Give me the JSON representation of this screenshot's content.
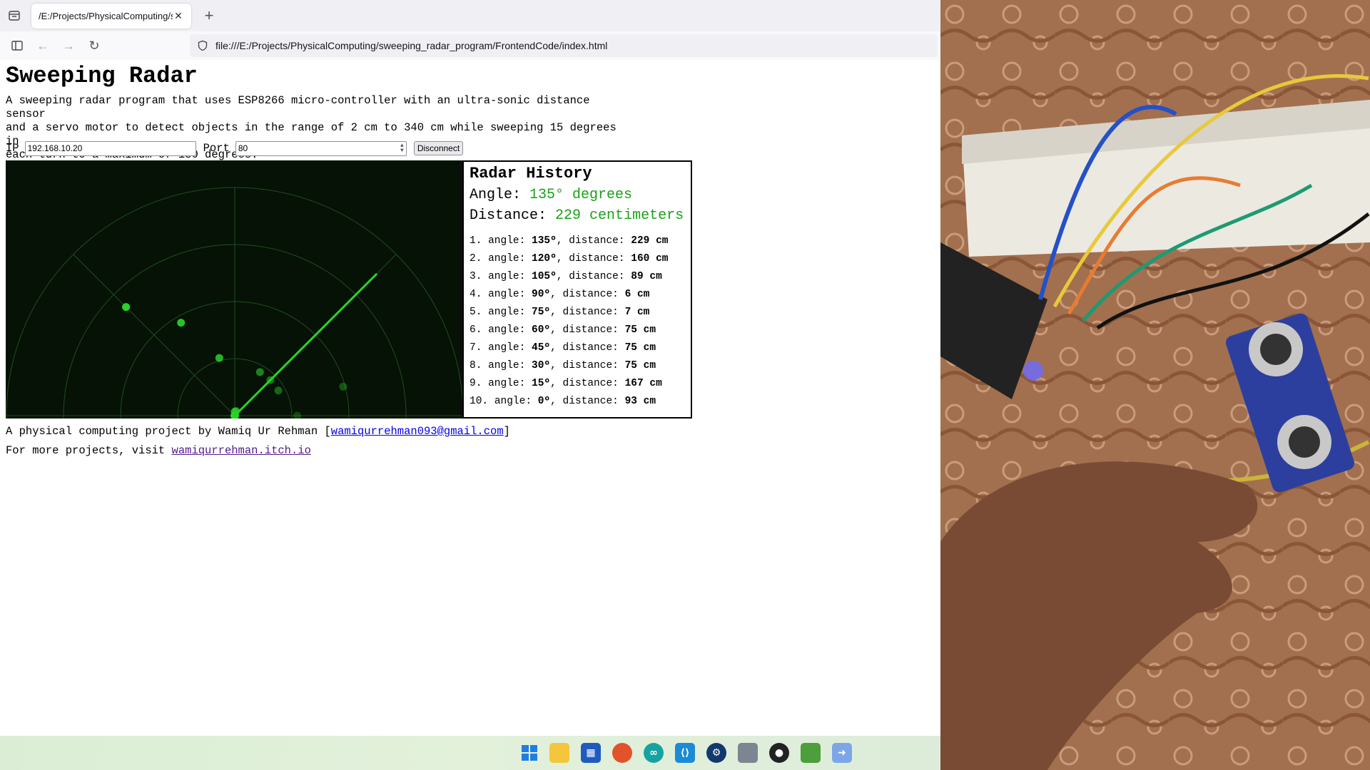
{
  "browser": {
    "tab_title": "/E:/Projects/PhysicalComputing/swe",
    "url": "file:///E:/Projects/PhysicalComputing/sweeping_radar_program/FrontendCode/index.html"
  },
  "page": {
    "title": "Sweeping Radar",
    "description_lines": [
      "A sweeping radar program that uses ESP8266 micro-controller with an ultra-sonic distance sensor",
      "and a servo motor to detect objects in the range of 2 cm to 340 cm while sweeping 15 degrees in",
      "each turn to a maximum of 180 degrees."
    ],
    "connection": {
      "ip_label": "IP",
      "ip_value": "192.168.10.20",
      "port_label": "Port",
      "port_value": "80",
      "button_label": "Disconnect"
    },
    "radar": {
      "max_range_cm": 340,
      "sweep_angle_deg": 135,
      "points": [
        {
          "angle": 135,
          "distance": 229
        },
        {
          "angle": 120,
          "distance": 160
        },
        {
          "angle": 105,
          "distance": 89
        },
        {
          "angle": 90,
          "distance": 6
        },
        {
          "angle": 75,
          "distance": 7
        },
        {
          "angle": 60,
          "distance": 75
        },
        {
          "angle": 45,
          "distance": 75
        },
        {
          "angle": 30,
          "distance": 75
        },
        {
          "angle": 15,
          "distance": 167
        },
        {
          "angle": 0,
          "distance": 93
        }
      ]
    },
    "history": {
      "title": "Radar History",
      "angle_label": "Angle:",
      "angle_value": "135° degrees",
      "distance_label": "Distance:",
      "distance_value": "229 centimeters",
      "entries": [
        {
          "num": "1.",
          "angle": "135º",
          "distance": "229 cm"
        },
        {
          "num": "2.",
          "angle": "120º",
          "distance": "160 cm"
        },
        {
          "num": "3.",
          "angle": "105º",
          "distance": "89 cm"
        },
        {
          "num": "4.",
          "angle": "90º",
          "distance": "6 cm"
        },
        {
          "num": "5.",
          "angle": "75º",
          "distance": "7 cm"
        },
        {
          "num": "6.",
          "angle": "60º",
          "distance": "75 cm"
        },
        {
          "num": "7.",
          "angle": "45º",
          "distance": "75 cm"
        },
        {
          "num": "8.",
          "angle": "30º",
          "distance": "75 cm"
        },
        {
          "num": "9.",
          "angle": "15º",
          "distance": "167 cm"
        },
        {
          "num": "10.",
          "angle": "0º",
          "distance": "93 cm"
        }
      ],
      "angle_word": "angle:",
      "distance_word": "distance:"
    },
    "footer": {
      "line1_prefix": "A physical computing project by Wamiq Ur Rehman [",
      "email": "wamiqurrehman093@gmail.com",
      "line1_suffix": "]",
      "line2_prefix": "For more projects, visit ",
      "site": "wamiqurrehman.itch.io"
    }
  },
  "taskbar": {
    "icons": [
      "windows-start-icon",
      "file-explorer-icon",
      "store-icon",
      "firefox-icon",
      "arduino-icon",
      "vscode-icon",
      "steam-icon",
      "app-icon",
      "obs-icon",
      "game-icon",
      "arrow-app-icon"
    ]
  },
  "colors": {
    "radar_bg": "#061206",
    "radar_grid": "#1f4d1f",
    "radar_line": "#28d428",
    "accent_green": "#19a119"
  }
}
